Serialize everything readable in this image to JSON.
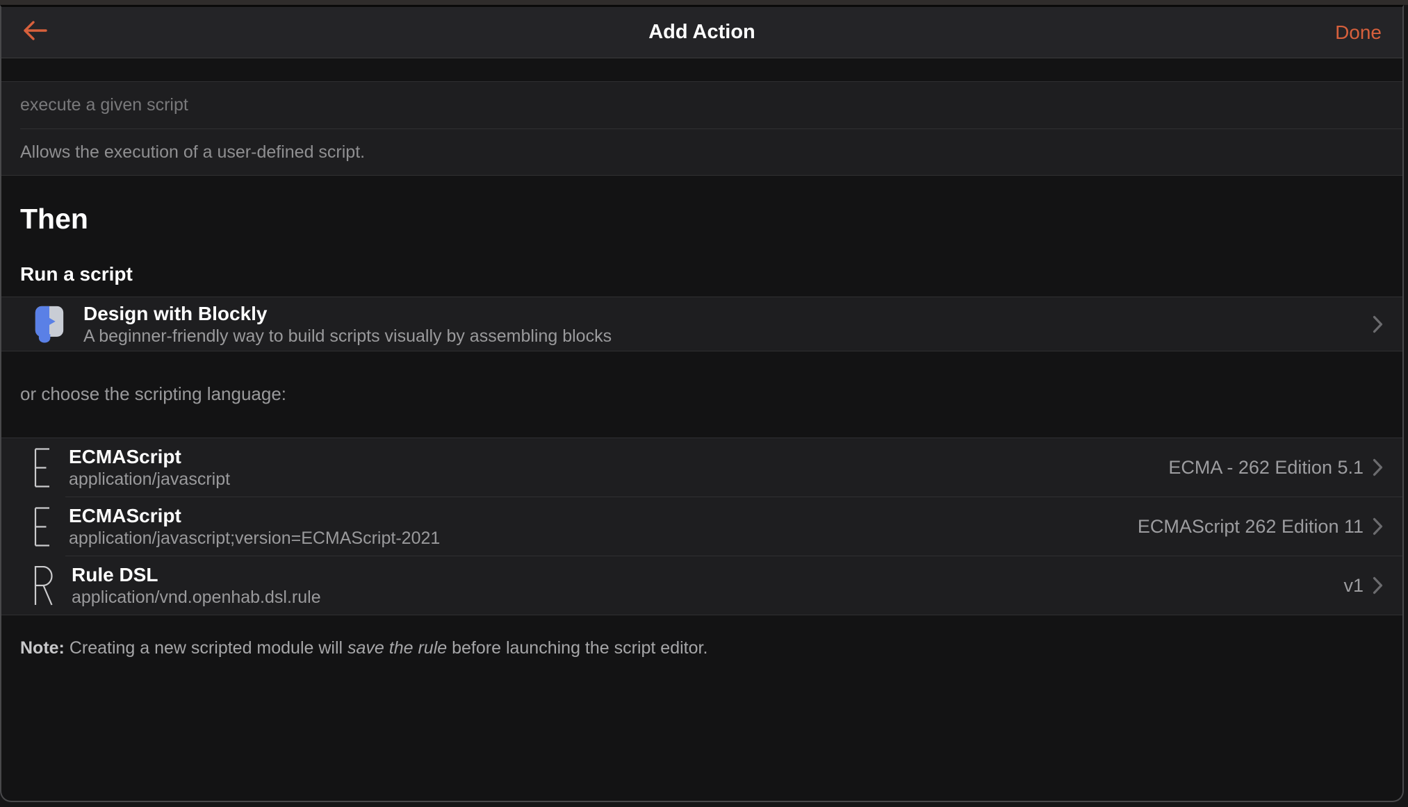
{
  "navbar": {
    "title": "Add Action",
    "done_label": "Done",
    "back_icon": "arrow-left-icon"
  },
  "module": {
    "name_placeholder": "execute a given script",
    "description": "Allows the execution of a user-defined script."
  },
  "section": {
    "heading": "Then",
    "subheading": "Run a script"
  },
  "blockly": {
    "icon": "blockly-block-icon",
    "title": "Design with Blockly",
    "subtitle": "A beginner-friendly way to build scripts visually by assembling blocks"
  },
  "choose_label": "or choose the scripting language:",
  "languages": [
    {
      "icon_glyph": "E",
      "title": "ECMAScript",
      "mime": "application/javascript",
      "version": "ECMA - 262 Edition 5.1"
    },
    {
      "icon_glyph": "E",
      "title": "ECMAScript",
      "mime": "application/javascript;version=ECMAScript-2021",
      "version": "ECMAScript 262 Edition 11"
    },
    {
      "icon_glyph": "R",
      "title": "Rule DSL",
      "mime": "application/vnd.openhab.dsl.rule",
      "version": "v1"
    }
  ],
  "note": {
    "prefix": "Note:",
    "before_italic": " Creating a new scripted module will ",
    "italic": "save the rule",
    "after_italic": " before launching the script editor."
  },
  "colors": {
    "accent": "#d7603c",
    "blockly_blue": "#5a80e6",
    "blockly_gray": "#c9cdd5",
    "row_bg": "#1e1e20",
    "page_bg": "#131314",
    "navbar_bg": "#242427"
  }
}
